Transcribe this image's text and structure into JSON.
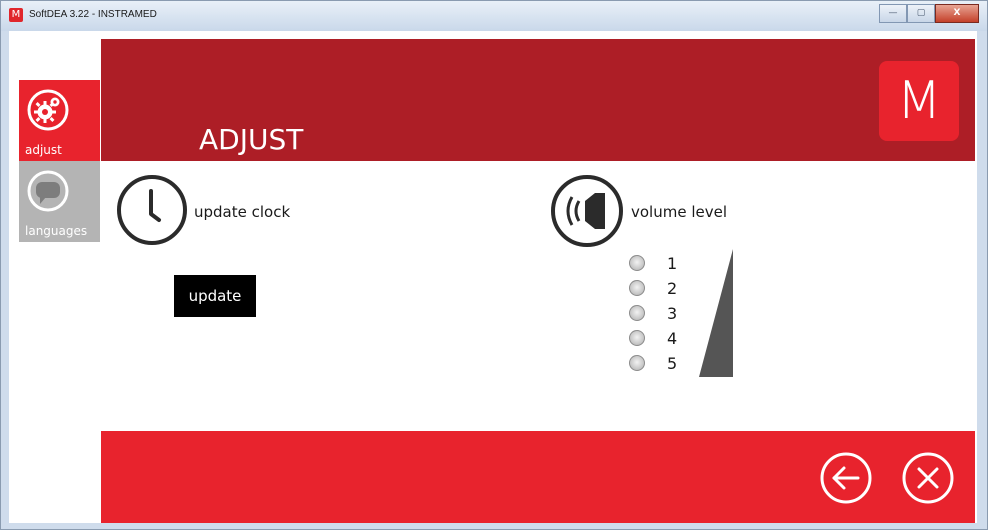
{
  "window": {
    "title": "SoftDEA 3.22 - INSTRAMED",
    "app_icon_letter": "M",
    "minimize_glyph": "—",
    "maximize_glyph": "▢",
    "close_glyph": "X"
  },
  "header": {
    "title": "ADJUST",
    "logo_letter": "M",
    "bg_color": "#ad1e26",
    "logo_color": "#e8232d"
  },
  "sidebar": {
    "items": [
      {
        "label": "adjust",
        "icon": "gear-icon",
        "active": true,
        "color": "#e8232d"
      },
      {
        "label": "languages",
        "icon": "speech-bubble-icon",
        "active": false,
        "color": "#b4b4b4"
      }
    ]
  },
  "clock_section": {
    "icon": "clock-icon",
    "label": "update clock",
    "button_label": "update"
  },
  "volume_section": {
    "icon": "speaker-icon",
    "label": "volume level",
    "levels": [
      "1",
      "2",
      "3",
      "4",
      "5"
    ],
    "selected": null
  },
  "footer": {
    "bg_color": "#e8232d",
    "back_icon": "back-arrow-icon",
    "close_icon": "close-icon"
  }
}
